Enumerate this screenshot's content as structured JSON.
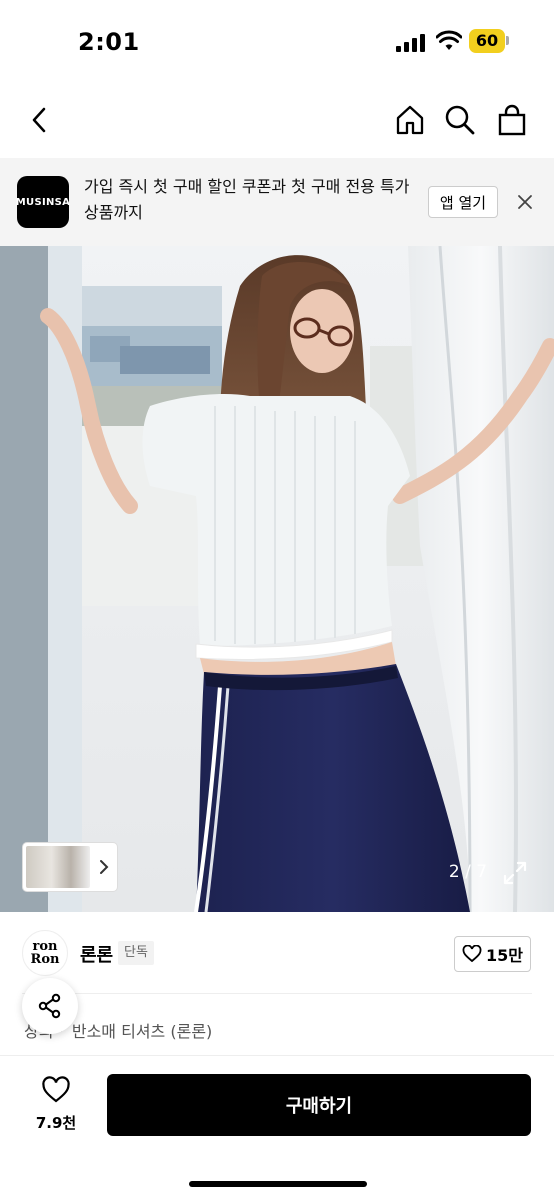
{
  "status_bar": {
    "time": "2:01",
    "battery": "60",
    "battery_color": "#f2cf1e"
  },
  "nav": {
    "back_icon": "chevron-left-icon",
    "home_icon": "home-icon",
    "search_icon": "search-icon",
    "cart_icon": "shopping-bag-icon"
  },
  "app_banner": {
    "logo_text": "MUSINSA",
    "message": "가입 즉시 첫 구매 할인 쿠폰과 첫 구매 전용 특가 상품까지",
    "open_label": "앱 열기",
    "close_icon": "close-icon"
  },
  "gallery": {
    "page_counter": "2 / 7",
    "current_page": 2,
    "total_pages": 7
  },
  "store": {
    "logo_line1": "ron",
    "logo_line2": "Ron",
    "name": "론론",
    "badge": "단독",
    "like_count": "15만"
  },
  "breadcrumb": {
    "category": "상의",
    "subcategory": "반소매 티셔츠 (론론)"
  },
  "bottom_bar": {
    "wishlist_count": "7.9천",
    "buy_label": "구매하기"
  }
}
